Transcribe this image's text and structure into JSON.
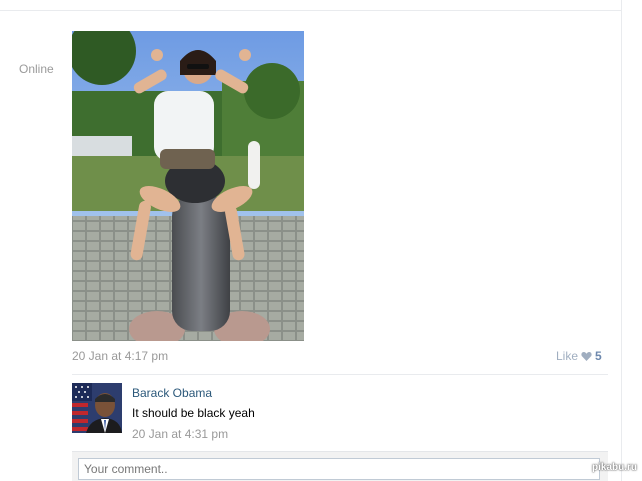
{
  "profile": {
    "status": "Online"
  },
  "post": {
    "time": "20 Jan at 4:17 pm",
    "like_label": "Like",
    "like_count": "5",
    "photo": {
      "description_icon": "photo-thumbnail"
    }
  },
  "comment": {
    "author": "Barack Obama",
    "text": "It should be black yeah",
    "time": "20 Jan at 4:31 pm"
  },
  "reply": {
    "placeholder": "Your comment..",
    "value": ""
  },
  "watermark": "pikabu.ru",
  "colors": {
    "link": "#2b587a",
    "muted": "#999999",
    "like_heart": "#a0aec0",
    "input_border": "#c0cad5",
    "reply_bg": "#f2f2f2"
  }
}
